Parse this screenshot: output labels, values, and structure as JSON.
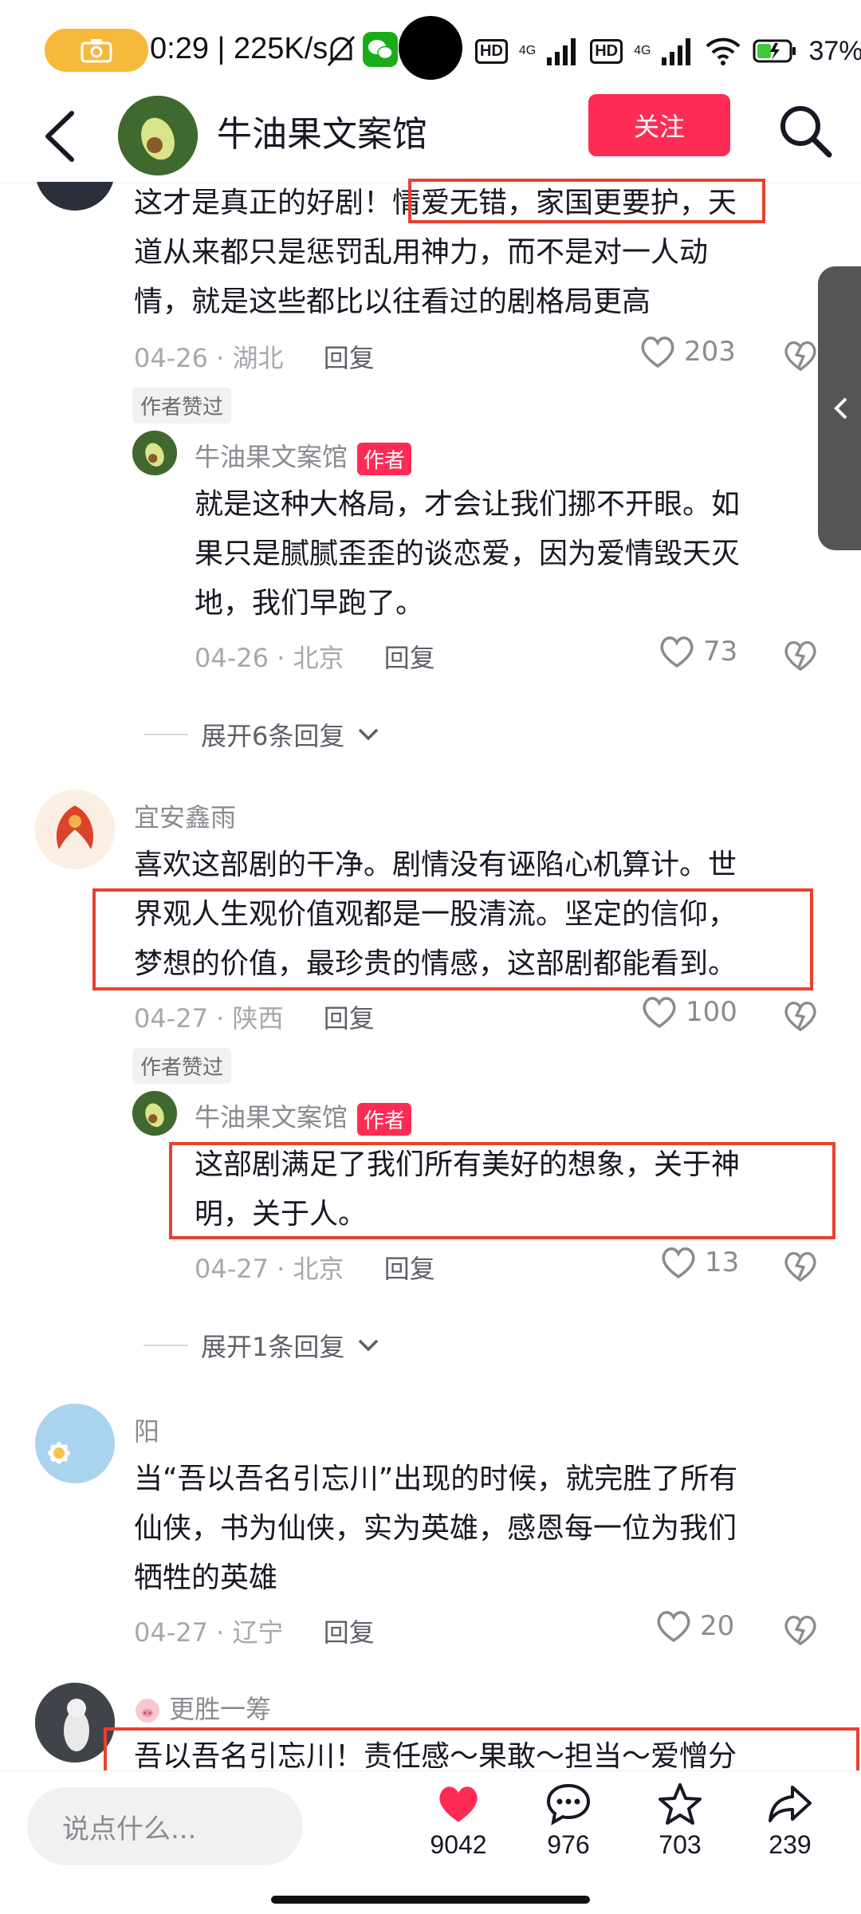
{
  "status_bar": {
    "time": "0:29",
    "speed": "225K/s",
    "network_1": "4G",
    "network_2": "4G",
    "battery": "37%"
  },
  "header": {
    "title": "牛油果文案馆",
    "follow_label": "关注"
  },
  "comments": [
    {
      "id": "c1",
      "text_lines": [
        "这才是真正的好剧！情爱无错，家国更要护，天",
        "道从来都只是惩罚乱用神力，而不是对一人动",
        "情，就是这些都比以往看过的剧格局更高"
      ],
      "date": "04-26",
      "region": "湖北",
      "reply_label": "回复",
      "likes": "203",
      "author_liked": "作者赞过",
      "reply": {
        "username": "牛油果文案馆",
        "author_tag": "作者",
        "text_lines": [
          "就是这种大格局，才会让我们挪不开眼。如",
          "果只是腻腻歪歪的谈恋爱，因为爱情毁天灭",
          "地，我们早跑了。"
        ],
        "date": "04-26",
        "region": "北京",
        "reply_label": "回复",
        "likes": "73"
      },
      "expand_label": "展开6条回复"
    },
    {
      "id": "c2",
      "username": "宜安鑫雨",
      "text_lines": [
        "喜欢这部剧的干净。剧情没有诬陷心机算计。世",
        "界观人生观价值观都是一股清流。坚定的信仰，",
        "梦想的价值，最珍贵的情感，这部剧都能看到。"
      ],
      "date": "04-27",
      "region": "陕西",
      "reply_label": "回复",
      "likes": "100",
      "author_liked": "作者赞过",
      "reply": {
        "username": "牛油果文案馆",
        "author_tag": "作者",
        "text_lines": [
          "这部剧满足了我们所有美好的想象，关于神",
          "明，关于人。"
        ],
        "date": "04-27",
        "region": "北京",
        "reply_label": "回复",
        "likes": "13"
      },
      "expand_label": "展开1条回复"
    },
    {
      "id": "c3",
      "username": "阳",
      "text_lines": [
        "当“吾以吾名引忘川”出现的时候，就完胜了所有",
        "仙侠，书为仙侠，实为英雄，感恩每一位为我们",
        "牺牲的英雄"
      ],
      "date": "04-27",
      "region": "辽宁",
      "reply_label": "回复",
      "likes": "20"
    },
    {
      "id": "c4",
      "username": "更胜一筹",
      "text_lines": [
        "吾以吾名引忘川！责任感～果敢～担当～爱憎分"
      ]
    }
  ],
  "bottom_bar": {
    "input_placeholder": "说点什么...",
    "like_count": "9042",
    "comment_count": "976",
    "favorite_count": "703",
    "share_count": "239"
  },
  "colors": {
    "accent": "#fe2c55",
    "highlight_box": "#e8412f"
  }
}
